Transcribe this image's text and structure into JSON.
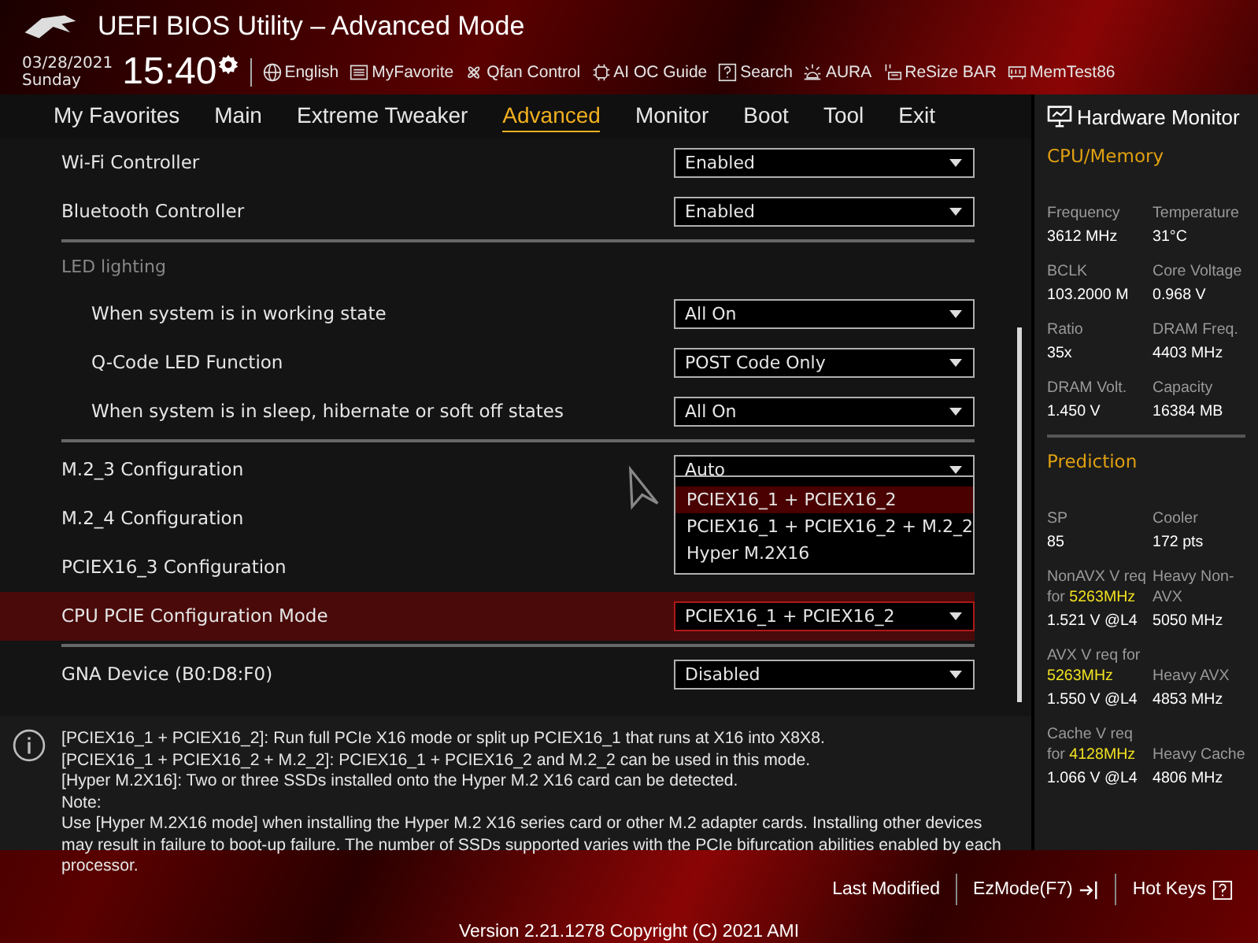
{
  "window": {
    "title": "UEFI BIOS Utility – Advanced Mode"
  },
  "clock": {
    "date": "03/28/2021",
    "day": "Sunday",
    "time": "15:40"
  },
  "toolbar": [
    {
      "label": "English",
      "kind": "globe"
    },
    {
      "label": "MyFavorite",
      "kind": "list"
    },
    {
      "label": "Qfan Control",
      "kind": "fan"
    },
    {
      "label": "AI OC Guide",
      "kind": "chip"
    },
    {
      "label": "Search",
      "kind": "question"
    },
    {
      "label": "AURA",
      "kind": "light"
    },
    {
      "label": "ReSize BAR",
      "kind": "bar"
    },
    {
      "label": "MemTest86",
      "kind": "memory"
    }
  ],
  "tabs": [
    {
      "label": "My Favorites",
      "selected": false
    },
    {
      "label": "Main",
      "selected": false
    },
    {
      "label": "Extreme Tweaker",
      "selected": false
    },
    {
      "label": "Advanced",
      "selected": true
    },
    {
      "label": "Monitor",
      "selected": false
    },
    {
      "label": "Boot",
      "selected": false
    },
    {
      "label": "Tool",
      "selected": false
    },
    {
      "label": "Exit",
      "selected": false
    }
  ],
  "groups": [
    {
      "items": [
        {
          "label": "Wi-Fi Controller",
          "value": "Enabled",
          "selected": false
        },
        {
          "label": "Bluetooth Controller",
          "value": "Enabled",
          "selected": false
        }
      ]
    },
    {
      "heading": "LED lighting",
      "items": [
        {
          "label": "When system is in working state",
          "value": "All On",
          "selected": false
        },
        {
          "label": "Q-Code LED Function",
          "value": "POST Code Only",
          "selected": false
        },
        {
          "label": "When system is in sleep, hibernate or soft off states",
          "value": "All On",
          "selected": false
        }
      ],
      "indented": true
    },
    {
      "items": [
        {
          "label": "M.2_3 Configuration",
          "value": "Auto",
          "selected": false
        },
        {
          "label": "M.2_4 Configuration",
          "selected": false
        },
        {
          "label": "PCIEX16_3 Configuration",
          "selected": false
        },
        {
          "label": "CPU PCIE Configuration Mode",
          "value": "PCIEX16_1 + PCIEX16_2",
          "selected": true,
          "options": [
            {
              "label": "PCIEX16_1 + PCIEX16_2",
              "selected": true
            },
            {
              "label": "PCIEX16_1 + PCIEX16_2 + M.2_2",
              "selected": false
            },
            {
              "label": "Hyper M.2X16",
              "selected": false
            }
          ]
        }
      ]
    },
    {
      "items": [
        {
          "label": "GNA Device (B0:D8:F0)",
          "value": "Disabled",
          "selected": false
        }
      ]
    }
  ],
  "help": [
    "[PCIEX16_1 + PCIEX16_2]: Run full PCIe X16 mode or split up PCIEX16_1 that runs at X16 into X8X8.",
    "[PCIEX16_1 + PCIEX16_2 + M.2_2]: PCIEX16_1 + PCIEX16_2 and M.2_2 can be used in this mode.",
    "[Hyper M.2X16]: Two or three SSDs installed onto the Hyper M.2 X16 card can be detected.",
    "Note:",
    "Use [Hyper M.2X16 mode] when installing the Hyper M.2 X16 series card or other M.2 adapter cards. Installing other devices may result in failure to boot-up failure. The number of SSDs supported varies with the PCIe bifurcation abilities enabled by each processor."
  ],
  "hardware_monitor": {
    "title": "Hardware Monitor",
    "sections": [
      {
        "title": "CPU/Memory",
        "items": [
          {
            "label": "Frequency",
            "value": "3612 MHz"
          },
          {
            "label": "Temperature",
            "value": "31°C"
          },
          {
            "label": "BCLK",
            "value": "103.2000 M"
          },
          {
            "label": "Core Voltage",
            "value": "0.968 V"
          },
          {
            "label": "Ratio",
            "value": "35x"
          },
          {
            "label": "DRAM Freq.",
            "value": "4403 MHz"
          },
          {
            "label": "DRAM Volt.",
            "value": "1.450 V"
          },
          {
            "label": "Capacity",
            "value": "16384 MB"
          }
        ]
      },
      {
        "title": "Prediction",
        "items": [
          {
            "label": "SP",
            "value": "85"
          },
          {
            "label": "Cooler",
            "value": "172 pts"
          },
          {
            "label": "NonAVX V req for **5263MHz**",
            "value": "1.521 V @L4"
          },
          {
            "label": "Heavy Non-AVX",
            "value": "5050 MHz"
          },
          {
            "label": "AVX V req for **5263MHz**",
            "value": "1.550 V @L4"
          },
          {
            "label": "Heavy AVX",
            "value": "4853 MHz"
          },
          {
            "label": "Cache V req for **4128MHz**",
            "value": "1.066 V @L4"
          },
          {
            "label": "Heavy Cache",
            "value": "4806 MHz"
          }
        ]
      }
    ]
  },
  "footer": {
    "buttons": [
      {
        "label": "Last Modified",
        "kind": "text"
      },
      {
        "label": "EzMode(F7)",
        "kind": "exit"
      },
      {
        "label": "Hot Keys",
        "kind": "question"
      }
    ],
    "version": "Version 2.21.1278 Copyright (C) 2021 AMI"
  }
}
